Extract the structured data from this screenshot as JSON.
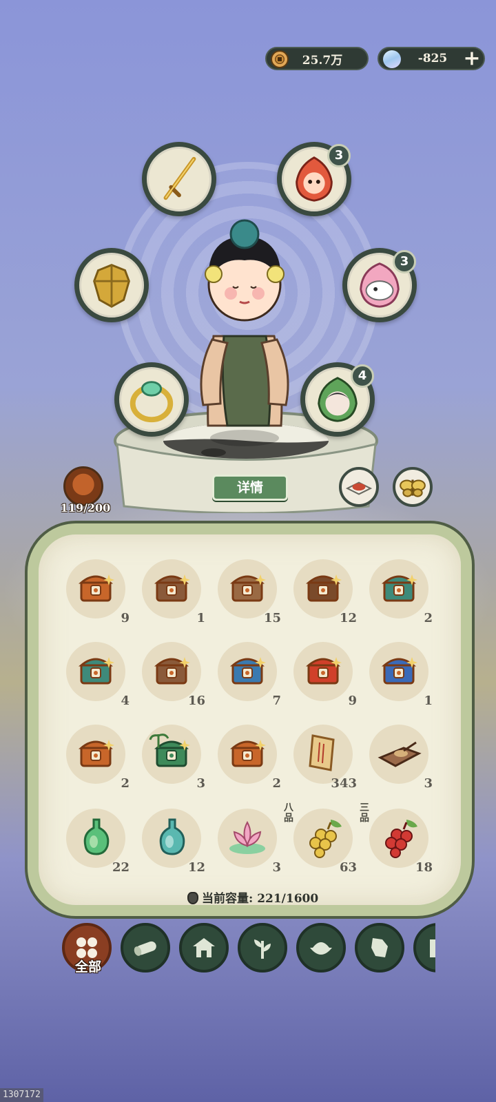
{
  "currencies": {
    "coins": "25.7万",
    "gems": "-825",
    "add_label": "+"
  },
  "equipment": {
    "charm_top_right": "3",
    "charm_mid_right": "3",
    "charm_low_right": "4"
  },
  "character": {
    "detail_label": "详情",
    "level": "119/200"
  },
  "inventory": {
    "items": [
      {
        "count": "9",
        "icon": "treasure-chest-icon"
      },
      {
        "count": "1",
        "icon": "treasure-chest-icon"
      },
      {
        "count": "15",
        "icon": "treasure-chest-icon"
      },
      {
        "count": "12",
        "icon": "treasure-chest-icon"
      },
      {
        "count": "2",
        "icon": "treasure-chest-icon"
      },
      {
        "count": "4",
        "icon": "treasure-chest-icon"
      },
      {
        "count": "16",
        "icon": "treasure-chest-icon"
      },
      {
        "count": "7",
        "icon": "treasure-chest-icon"
      },
      {
        "count": "9",
        "icon": "treasure-chest-icon"
      },
      {
        "count": "1",
        "icon": "treasure-chest-icon"
      },
      {
        "count": "2",
        "icon": "treasure-chest-icon"
      },
      {
        "count": "3",
        "icon": "tropical-chest-icon"
      },
      {
        "count": "2",
        "icon": "treasure-chest-icon"
      },
      {
        "count": "343",
        "icon": "scroll-icon"
      },
      {
        "count": "3",
        "icon": "ink-stone-icon"
      },
      {
        "count": "22",
        "icon": "green-potion-icon"
      },
      {
        "count": "12",
        "icon": "teal-potion-icon"
      },
      {
        "count": "3",
        "icon": "lotus-icon"
      },
      {
        "count": "63",
        "icon": "yellow-berries-icon",
        "grade": "八品"
      },
      {
        "count": "18",
        "icon": "red-berries-icon",
        "grade": "三品"
      }
    ],
    "capacity_label": "当前容量: 221/1600"
  },
  "tabs": {
    "all_label": "全部",
    "items": [
      "all-tab",
      "wood-tab",
      "house-tab",
      "herb-tab",
      "food-tab",
      "map-tab",
      "book-tab"
    ]
  },
  "watermark": "1307172",
  "colors": {
    "panel_border": "#bdc99d",
    "tab_active": "#8a3e22",
    "tab_bg": "#2f4a3a",
    "detail_button": "#5b8a5e"
  }
}
